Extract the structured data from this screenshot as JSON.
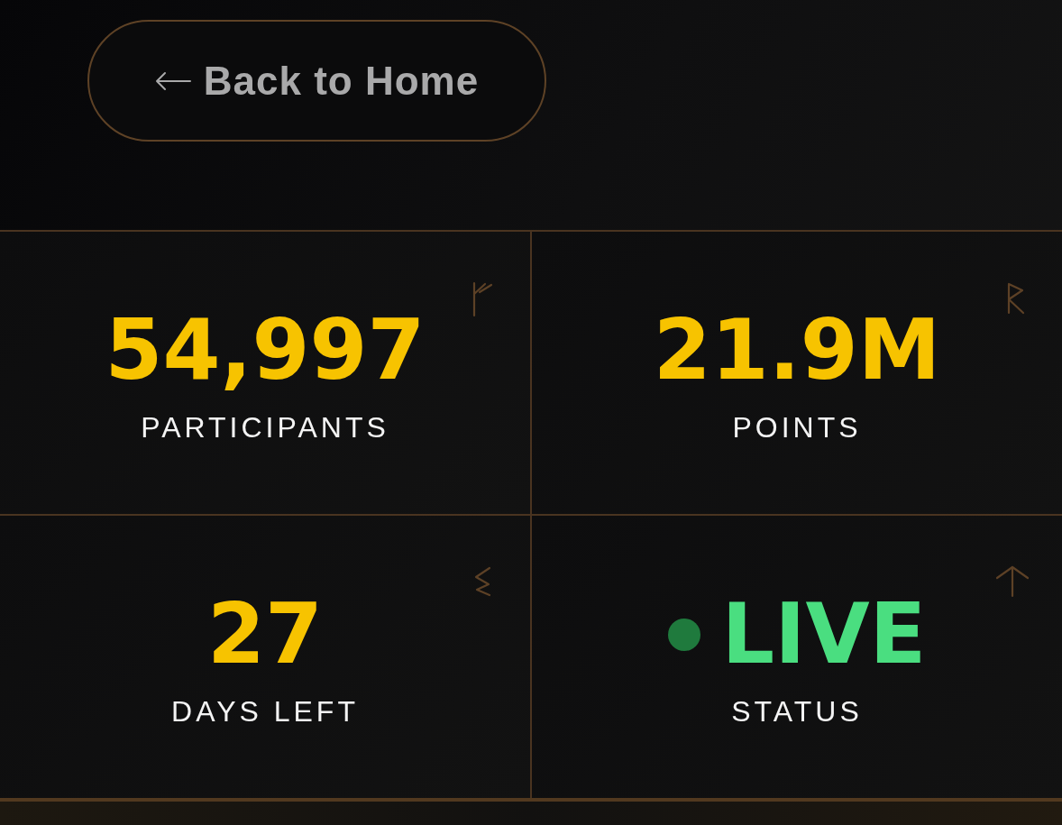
{
  "back_button": {
    "label": "Back to Home"
  },
  "stats": [
    {
      "kind": "count",
      "value": "54,997",
      "label": "PARTICIPANTS"
    },
    {
      "kind": "count",
      "value": "21.9M",
      "label": "POINTS"
    },
    {
      "kind": "count",
      "value": "27",
      "label": "DAYS LEFT"
    },
    {
      "kind": "status",
      "value": "LIVE",
      "label": "STATUS"
    }
  ]
}
